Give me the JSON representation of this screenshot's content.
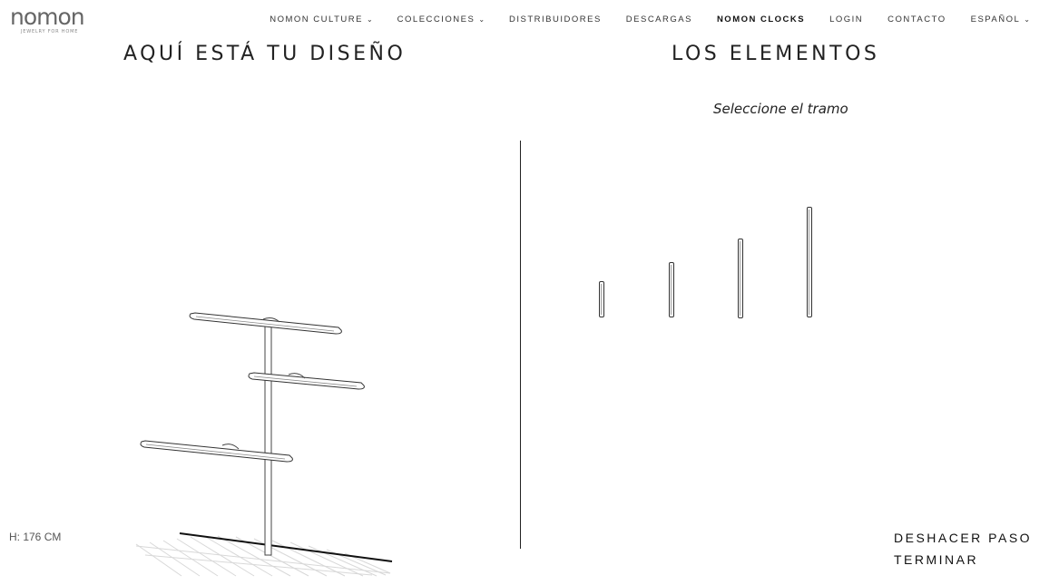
{
  "logo": {
    "name": "nomon",
    "tagline": "JEWELRY FOR HOME"
  },
  "nav": {
    "items": [
      {
        "label": "NOMON CULTURE",
        "has_caret": true,
        "bold": false
      },
      {
        "label": "COLECCIONES",
        "has_caret": true,
        "bold": false
      },
      {
        "label": "DISTRIBUIDORES",
        "has_caret": false,
        "bold": false
      },
      {
        "label": "DESCARGAS",
        "has_caret": false,
        "bold": false
      },
      {
        "label": "NOMON CLOCKS",
        "has_caret": false,
        "bold": true
      },
      {
        "label": "LOGIN",
        "has_caret": false,
        "bold": false
      },
      {
        "label": "CONTACTO",
        "has_caret": false,
        "bold": false
      },
      {
        "label": "ESPAÑOL",
        "has_caret": true,
        "bold": false
      }
    ],
    "caret_icon": "chevron-down-icon"
  },
  "design": {
    "title": "AQUÍ ESTÁ TU DISEÑO",
    "height_label": "H: 176 CM"
  },
  "elements": {
    "title": "LOS ELEMENTOS",
    "subtitle": "Seleccione el tramo",
    "tramos": [
      {
        "size_rank": 1
      },
      {
        "size_rank": 2
      },
      {
        "size_rank": 3
      },
      {
        "size_rank": 4
      }
    ]
  },
  "actions": {
    "undo": "DESHACER PASO",
    "finish": "TERMINAR"
  }
}
